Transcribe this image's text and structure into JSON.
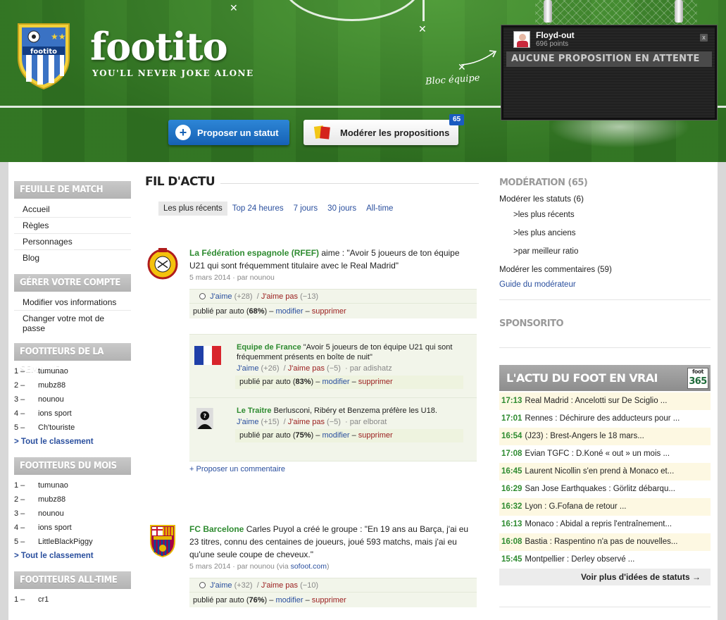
{
  "header": {
    "brand": "footito",
    "crest_label": "footito",
    "tagline": "YOU'LL NEVER JOKE ALONE",
    "bloc_label": "Bloc équipe",
    "propose_button": "Proposer un statut",
    "moderate_button": "Modérer les propositions",
    "moderate_badge": "65"
  },
  "user": {
    "name": "Floyd-out",
    "points": "696 points",
    "close_label": "x",
    "pending": "AUCUNE PROPOSITION EN ATTENTE"
  },
  "left": {
    "match_sheet": {
      "title": "FEUILLE DE MATCH",
      "items": [
        "Accueil",
        "Règles",
        "Personnages",
        "Blog"
      ]
    },
    "account": {
      "title": "GÉRER VOTRE COMPTE",
      "items": [
        "Modifier vos informations",
        "Changer votre mot de passe"
      ]
    },
    "week": {
      "title": "FOOTITEURS DE LA SEMAINE",
      "ranks": [
        {
          "n": "1 –",
          "name": "tumunao"
        },
        {
          "n": "2 –",
          "name": "mubz88"
        },
        {
          "n": "3 –",
          "name": "nounou"
        },
        {
          "n": "4 –",
          "name": "ions sport"
        },
        {
          "n": "5 –",
          "name": "Ch'touriste"
        }
      ],
      "all_link": "> Tout le classement"
    },
    "month": {
      "title": "FOOTITEURS DU MOIS",
      "ranks": [
        {
          "n": "1 –",
          "name": "tumunao"
        },
        {
          "n": "2 –",
          "name": "mubz88"
        },
        {
          "n": "3 –",
          "name": "nounou"
        },
        {
          "n": "4 –",
          "name": "ions sport"
        },
        {
          "n": "5 –",
          "name": "LittleBlackPiggy"
        }
      ],
      "all_link": "> Tout le classement"
    },
    "alltime": {
      "title": "FOOTITEURS ALL-TIME",
      "ranks": [
        {
          "n": "1 –",
          "name": "cr1"
        }
      ]
    }
  },
  "feed": {
    "title": "FIL D'ACTU",
    "tabs": [
      "Les plus récents",
      "Top 24 heures",
      "7 jours",
      "30 jours",
      "All-time"
    ],
    "posts": [
      {
        "author": "La Fédération espagnole (RFEF)",
        "text": " aime : \"Avoir 5 joueurs de ton équipe U21 qui sont fréquemment titulaire avec le Real Madrid\"",
        "date": "5 mars 2014",
        "by": " · par nounou",
        "source": "",
        "like_label": "J'aime",
        "like_count": "(+28)",
        "dislike_label": "J'aime pas",
        "dislike_count": "(−13)",
        "pub_prefix": "publié par auto (",
        "pub_pct": "68%",
        "pub_suffix": ")",
        "modify": "modifier",
        "delete": "supprimer",
        "comments": [
          {
            "author": "Equipe de France",
            "text": " \"Avoir 5 joueurs de ton équipe U21 qui sont fréquemment présents en boîte de nuit\"",
            "like_label": "J'aime",
            "like_count": "(+26)",
            "dislike_label": "J'aime pas",
            "dislike_count": "(−5)",
            "by": "· par adishatz",
            "pub_prefix": "publié par auto (",
            "pub_pct": "83%",
            "pub_suffix": ")",
            "modify": "modifier",
            "delete": "supprimer"
          },
          {
            "author": "Le Traitre",
            "text": " Berlusconi, Ribéry et Benzema préfère les U18.",
            "like_label": "J'aime",
            "like_count": "(+15)",
            "dislike_label": "J'aime pas",
            "dislike_count": "(−5)",
            "by": "· par elborat",
            "pub_prefix": "publié par auto (",
            "pub_pct": "75%",
            "pub_suffix": ")",
            "modify": "modifier",
            "delete": "supprimer"
          }
        ],
        "propose_comment": "+ Proposer un commentaire"
      },
      {
        "author": "FC Barcelone",
        "text": " Carles Puyol a créé le groupe : \"En 19 ans au Barça, j'ai eu 23 titres, connu des centaines de joueurs, joué 593 matchs, mais j'ai eu qu'une seule coupe de cheveux.\"",
        "date": "5 mars 2014",
        "by": " · par nounou (via ",
        "source": "sofoot.com",
        "source_suffix": ")",
        "like_label": "J'aime",
        "like_count": "(+32)",
        "dislike_label": "J'aime pas",
        "dislike_count": "(−10)",
        "pub_prefix": "publié par auto (",
        "pub_pct": "76%",
        "pub_suffix": ")",
        "modify": "modifier",
        "delete": "supprimer"
      }
    ]
  },
  "right": {
    "moderation_title": "MODÉRATION (65)",
    "moderate_statuses": "Modérer les statuts (6)",
    "sub_items": [
      ">les plus récents",
      ">les plus anciens",
      ">par meilleur ratio"
    ],
    "moderate_comments": "Modérer les commentaires (59)",
    "guide": "Guide du modérateur",
    "sponsor_title": "SPONSORITO",
    "news_title": "L'ACTU DU FOOT EN VRAI",
    "news_logo_top": "foot",
    "news_logo_num": "365",
    "news": [
      {
        "time": "17:13",
        "text": "Real Madrid : Ancelotti sur De Sciglio ..."
      },
      {
        "time": "17:01",
        "text": "Rennes : Déchirure des adducteurs pour ..."
      },
      {
        "time": "16:54",
        "text": "(J23) : Brest-Angers le 18 mars..."
      },
      {
        "time": "17:08",
        "text": "Evian TGFC : D.Koné « out » un mois ..."
      },
      {
        "time": "16:45",
        "text": "Laurent Nicollin s'en prend à Monaco et..."
      },
      {
        "time": "16:29",
        "text": "San Jose Earthquakes : Görlitz débarqu..."
      },
      {
        "time": "16:32",
        "text": "Lyon : G.Fofana de retour ..."
      },
      {
        "time": "16:13",
        "text": "Monaco : Abidal a repris l'entraînement..."
      },
      {
        "time": "16:08",
        "text": "Bastia : Raspentino n'a pas de nouvelles..."
      },
      {
        "time": "15:45",
        "text": "Montpellier : Derley observé ..."
      }
    ],
    "more_ideas": "Voir plus d'idées de statuts →"
  }
}
